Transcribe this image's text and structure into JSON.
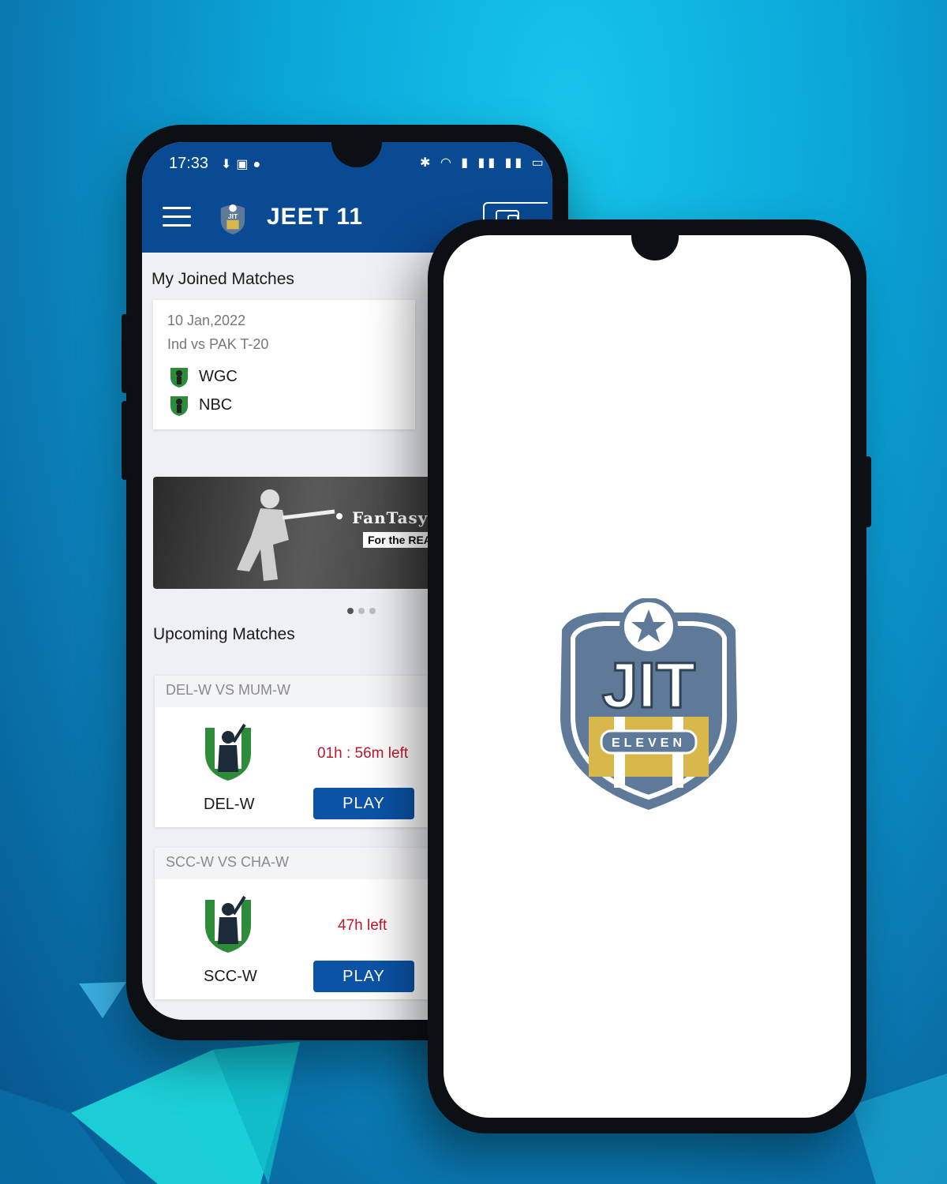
{
  "status_bar": {
    "time": "17:33"
  },
  "app": {
    "title": "JEET 11"
  },
  "joined": {
    "section_title": "My Joined Matches",
    "card": {
      "date": "10 Jan,2022",
      "match": "Ind vs PAK T-20",
      "teams": [
        "WGC",
        "NBC"
      ]
    }
  },
  "banner": {
    "brand": "FanTasy",
    "tagline": "For the REA"
  },
  "upcoming": {
    "section_title": "Upcoming Matches",
    "matches": [
      {
        "title": "DEL-W VS MUM-W",
        "team": "DEL-W",
        "time_left": "01h : 56m left",
        "play_label": "PLAY"
      },
      {
        "title": "SCC-W VS CHA-W",
        "team": "SCC-W",
        "time_left": "47h left",
        "play_label": "PLAY"
      }
    ]
  },
  "splash": {
    "logo_top": "JIT",
    "logo_bottom": "ELEVEN"
  },
  "colors": {
    "brand_blue": "#0a4a92",
    "play_blue": "#0b53a6",
    "time_red": "#c0172c",
    "logo_slate": "#5f7a98",
    "logo_gold": "#d8b84a"
  }
}
